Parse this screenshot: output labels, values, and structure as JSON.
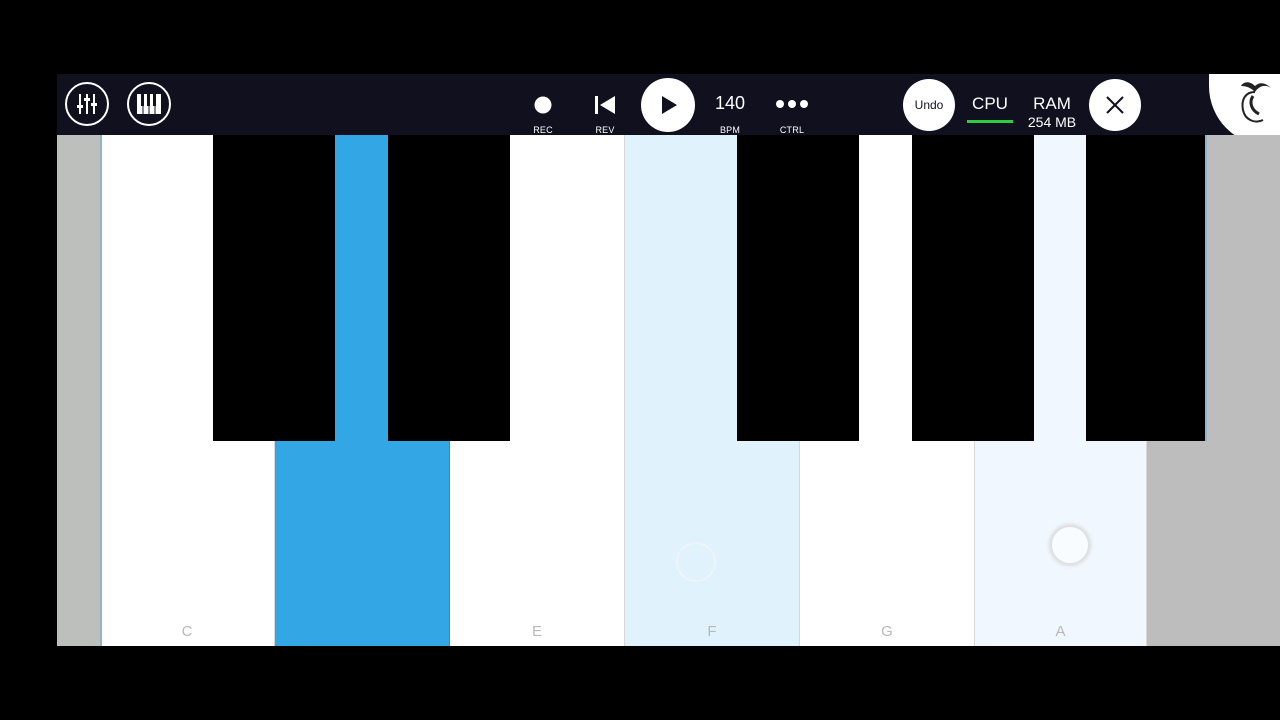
{
  "toolbar": {
    "rec_label": "REC",
    "rev_label": "REV",
    "bpm_value": "140",
    "bpm_label": "BPM",
    "ctrl_label": "CTRL",
    "undo_label": "Undo",
    "cpu_label": "CPU",
    "ram_label": "RAM",
    "ram_value": "254 MB"
  },
  "keyboard": {
    "white_keys": [
      {
        "note": "C",
        "state": "normal"
      },
      {
        "note": "",
        "state": "pressed"
      },
      {
        "note": "E",
        "state": "normal"
      },
      {
        "note": "F",
        "state": "highlight"
      },
      {
        "note": "G",
        "state": "normal"
      },
      {
        "note": "A",
        "state": "light"
      }
    ]
  },
  "colors": {
    "toolbar_bg": "#10101f",
    "pressed_key": "#33a7e6",
    "highlight_key": "#e0f2fc",
    "light_key": "#f0f7fe",
    "cpu_meter": "#2ecc40"
  }
}
